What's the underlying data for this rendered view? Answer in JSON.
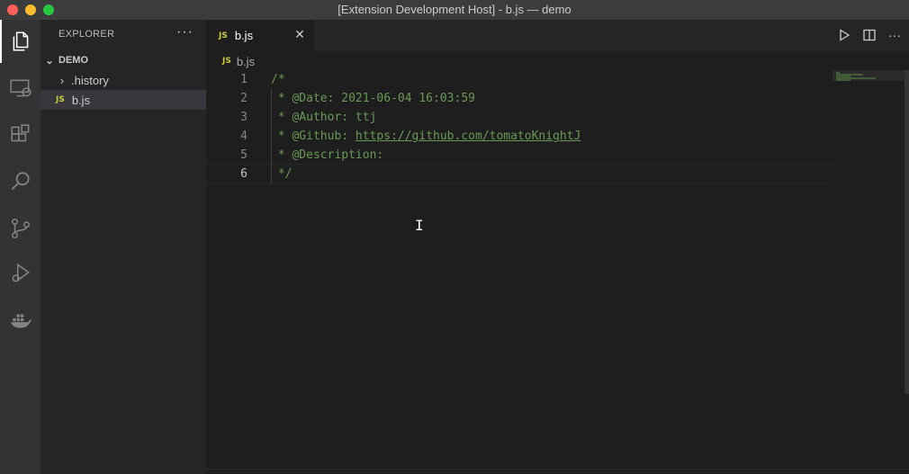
{
  "window": {
    "title": "[Extension Development Host] - b.js — demo"
  },
  "activity_bar": {
    "items": [
      {
        "icon": "files-icon"
      },
      {
        "icon": "remote-explorer-icon"
      },
      {
        "icon": "extensions-icon"
      },
      {
        "icon": "search-icon"
      },
      {
        "icon": "source-control-icon"
      },
      {
        "icon": "run-debug-icon"
      },
      {
        "icon": "docker-icon"
      }
    ]
  },
  "sidebar": {
    "header": "EXPLORER",
    "more": "···",
    "folder": "DEMO",
    "items": [
      {
        "label": ".history",
        "type": "folder"
      },
      {
        "label": "b.js",
        "type": "file",
        "badge": "JS"
      }
    ]
  },
  "editor": {
    "tab": {
      "badge": "JS",
      "label": "b.js",
      "close": "✕"
    },
    "breadcrumb": {
      "badge": "JS",
      "label": "b.js"
    },
    "lines": [
      {
        "num": "1",
        "text": "/*"
      },
      {
        "num": "2",
        "text": " * @Date: 2021-06-04 16:03:59"
      },
      {
        "num": "3",
        "text": " * @Author: ttj"
      },
      {
        "num": "4",
        "prefix": " * @Github: ",
        "link": "https://github.com/tomatoKnightJ"
      },
      {
        "num": "5",
        "text": " * @Description: "
      },
      {
        "num": "6",
        "text": " */"
      }
    ]
  },
  "colors": {
    "comment": "#6a9955",
    "js_badge": "#cbcb41",
    "background": "#1e1e1e"
  }
}
